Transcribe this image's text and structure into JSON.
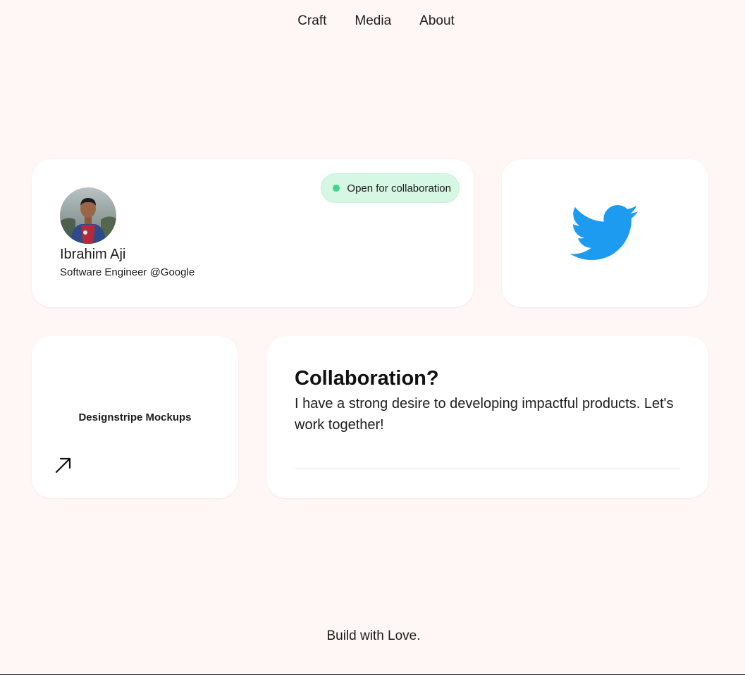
{
  "nav": {
    "items": [
      {
        "label": "Craft"
      },
      {
        "label": "Media"
      },
      {
        "label": "About"
      }
    ]
  },
  "profile": {
    "status_badge": "Open for collaboration",
    "name": "Ibrahim Aji",
    "role": "Software Engineer @Google",
    "avatar_icon": "avatar-photo"
  },
  "twitter": {
    "icon": "twitter-bird-icon",
    "color": "#1d9bf0"
  },
  "mockups": {
    "label": "Designstripe Mockups",
    "icon": "arrow-up-right-icon"
  },
  "collaboration": {
    "title": "Collaboration?",
    "text": "I have a strong desire to developing impactful products. Let's work together!"
  },
  "footer": {
    "text": "Build with Love."
  },
  "colors": {
    "background": "#fff6f6",
    "card": "#ffffff",
    "badge_bg": "#d5f7e4",
    "status_dot": "#3fd68b",
    "twitter_blue": "#1d9bf0"
  }
}
